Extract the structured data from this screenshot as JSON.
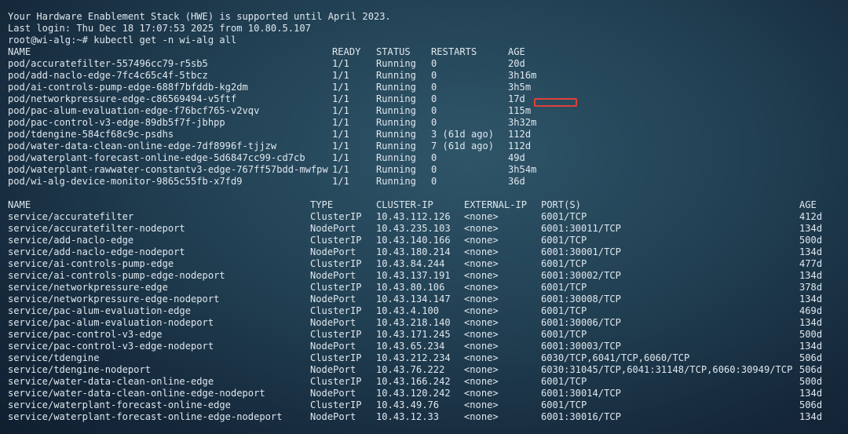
{
  "header": {
    "hwe_line": "Your Hardware Enablement Stack (HWE) is supported until April 2023.",
    "last_login": "Last login: Thu Dec 18 17:07:53 2025 from 10.80.5.107",
    "prompt": "root@wi-alg:~# kubectl get -n wi-alg all"
  },
  "pods": {
    "headers": [
      "NAME",
      "READY",
      "STATUS",
      "RESTARTS",
      "AGE"
    ],
    "rows": [
      [
        "pod/accuratefilter-557496cc79-r5sb5",
        "1/1",
        "Running",
        "0",
        "20d"
      ],
      [
        "pod/add-naclo-edge-7fc4c65c4f-5tbcz",
        "1/1",
        "Running",
        "0",
        "3h16m"
      ],
      [
        "pod/ai-controls-pump-edge-688f7bfddb-kg2dm",
        "1/1",
        "Running",
        "0",
        "3h5m"
      ],
      [
        "pod/networkpressure-edge-c86569494-v5ftf",
        "1/1",
        "Running",
        "0",
        "17d"
      ],
      [
        "pod/pac-alum-evaluation-edge-f76bcf765-v2vqv",
        "1/1",
        "Running",
        "0",
        "115m"
      ],
      [
        "pod/pac-control-v3-edge-89db5f7f-jbhpp",
        "1/1",
        "Running",
        "0",
        "3h32m"
      ],
      [
        "pod/tdengine-584cf68c9c-psdhs",
        "1/1",
        "Running",
        "3 (61d ago)",
        "112d"
      ],
      [
        "pod/water-data-clean-online-edge-7df8996f-tjjzw",
        "1/1",
        "Running",
        "7 (61d ago)",
        "112d"
      ],
      [
        "pod/waterplant-forecast-online-edge-5d6847cc99-cd7cb",
        "1/1",
        "Running",
        "0",
        "49d"
      ],
      [
        "pod/waterplant-rawwater-constantv3-edge-767ff57bdd-mwfpw",
        "1/1",
        "Running",
        "0",
        "3h54m"
      ],
      [
        "pod/wi-alg-device-monitor-9865c55fb-x7fd9",
        "1/1",
        "Running",
        "0",
        "36d"
      ]
    ]
  },
  "services": {
    "headers": [
      "NAME",
      "TYPE",
      "CLUSTER-IP",
      "EXTERNAL-IP",
      "PORT(S)",
      "AGE"
    ],
    "rows": [
      [
        "service/accuratefilter",
        "ClusterIP",
        "10.43.112.126",
        "<none>",
        "6001/TCP",
        "412d"
      ],
      [
        "service/accuratefilter-nodeport",
        "NodePort",
        "10.43.235.103",
        "<none>",
        "6001:30011/TCP",
        "134d"
      ],
      [
        "service/add-naclo-edge",
        "ClusterIP",
        "10.43.140.166",
        "<none>",
        "6001/TCP",
        "500d"
      ],
      [
        "service/add-naclo-edge-nodeport",
        "NodePort",
        "10.43.180.214",
        "<none>",
        "6001:30001/TCP",
        "134d"
      ],
      [
        "service/ai-controls-pump-edge",
        "ClusterIP",
        "10.43.84.244",
        "<none>",
        "6001/TCP",
        "477d"
      ],
      [
        "service/ai-controls-pump-edge-nodeport",
        "NodePort",
        "10.43.137.191",
        "<none>",
        "6001:30002/TCP",
        "134d"
      ],
      [
        "service/networkpressure-edge",
        "ClusterIP",
        "10.43.80.106",
        "<none>",
        "6001/TCP",
        "378d"
      ],
      [
        "service/networkpressure-edge-nodeport",
        "NodePort",
        "10.43.134.147",
        "<none>",
        "6001:30008/TCP",
        "134d"
      ],
      [
        "service/pac-alum-evaluation-edge",
        "ClusterIP",
        "10.43.4.100",
        "<none>",
        "6001/TCP",
        "469d"
      ],
      [
        "service/pac-alum-evaluation-nodeport",
        "NodePort",
        "10.43.218.140",
        "<none>",
        "6001:30006/TCP",
        "134d"
      ],
      [
        "service/pac-control-v3-edge",
        "ClusterIP",
        "10.43.171.245",
        "<none>",
        "6001/TCP",
        "500d"
      ],
      [
        "service/pac-control-v3-edge-nodeport",
        "NodePort",
        "10.43.65.234",
        "<none>",
        "6001:30003/TCP",
        "134d"
      ],
      [
        "service/tdengine",
        "ClusterIP",
        "10.43.212.234",
        "<none>",
        "6030/TCP,6041/TCP,6060/TCP",
        "506d"
      ],
      [
        "service/tdengine-nodeport",
        "NodePort",
        "10.43.76.222",
        "<none>",
        "6030:31045/TCP,6041:31148/TCP,6060:30949/TCP",
        "506d"
      ],
      [
        "service/water-data-clean-online-edge",
        "ClusterIP",
        "10.43.166.242",
        "<none>",
        "6001/TCP",
        "500d"
      ],
      [
        "service/water-data-clean-online-edge-nodeport",
        "NodePort",
        "10.43.120.242",
        "<none>",
        "6001:30014/TCP",
        "134d"
      ],
      [
        "service/waterplant-forecast-online-edge",
        "ClusterIP",
        "10.43.49.76",
        "<none>",
        "6001/TCP",
        "506d"
      ],
      [
        "service/waterplant-forecast-online-edge-nodeport",
        "NodePort",
        "10.43.12.33",
        "<none>",
        "6001:30016/TCP",
        "134d"
      ]
    ]
  },
  "annotation": {
    "box_color": "#e0413a"
  }
}
